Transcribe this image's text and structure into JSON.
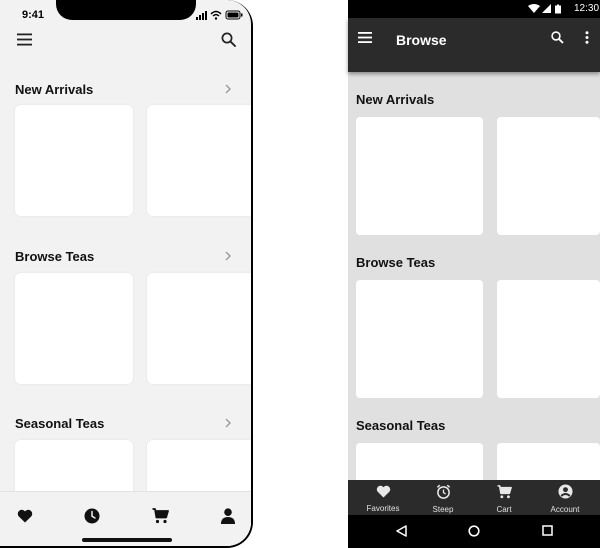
{
  "ios": {
    "status_time": "9:41",
    "sections": [
      {
        "title": "New Arrivals"
      },
      {
        "title": "Browse Teas"
      },
      {
        "title": "Seasonal Teas"
      }
    ],
    "tabbar_icons": [
      "heart-icon",
      "clock-icon",
      "cart-icon",
      "person-icon"
    ]
  },
  "android": {
    "status_time": "12:30",
    "app_title": "Browse",
    "sections": [
      {
        "title": "New Arrivals"
      },
      {
        "title": "Browse Teas"
      },
      {
        "title": "Seasonal Teas"
      }
    ],
    "bottom_nav": [
      {
        "label": "Favorites",
        "icon": "heart-icon"
      },
      {
        "label": "Steep",
        "icon": "alarm-icon"
      },
      {
        "label": "Cart",
        "icon": "cart-icon"
      },
      {
        "label": "Account",
        "icon": "account-icon"
      }
    ]
  },
  "colors": {
    "ios_background": "#f2f2f2",
    "android_appbar": "#2b2b2b",
    "android_background": "#e0e0e0"
  }
}
